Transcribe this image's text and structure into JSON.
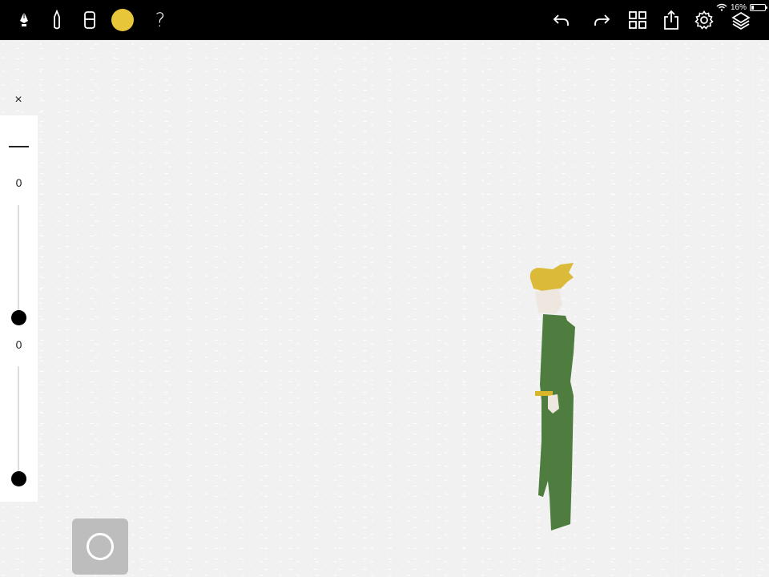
{
  "toolbar": {
    "tools": [
      "pen-icon",
      "brush-icon",
      "eraser-icon"
    ],
    "current_color": "#e8c63a",
    "help_label": "?",
    "right_actions": [
      "undo-icon",
      "redo-icon",
      "gallery-icon",
      "share-icon",
      "settings-icon",
      "layers-icon"
    ]
  },
  "status": {
    "battery_percent": "16%",
    "battery_level": 0.16
  },
  "side_panel": {
    "close_label": "×",
    "slider_top_value": "0",
    "slider_bottom_value": "0"
  },
  "colors": {
    "toolbar_bg": "#000000",
    "canvas_bg": "#f1f1f1",
    "figure_coat": "#4f7d3f",
    "figure_hair": "#d9b52a",
    "figure_skin": "#eee7df"
  }
}
